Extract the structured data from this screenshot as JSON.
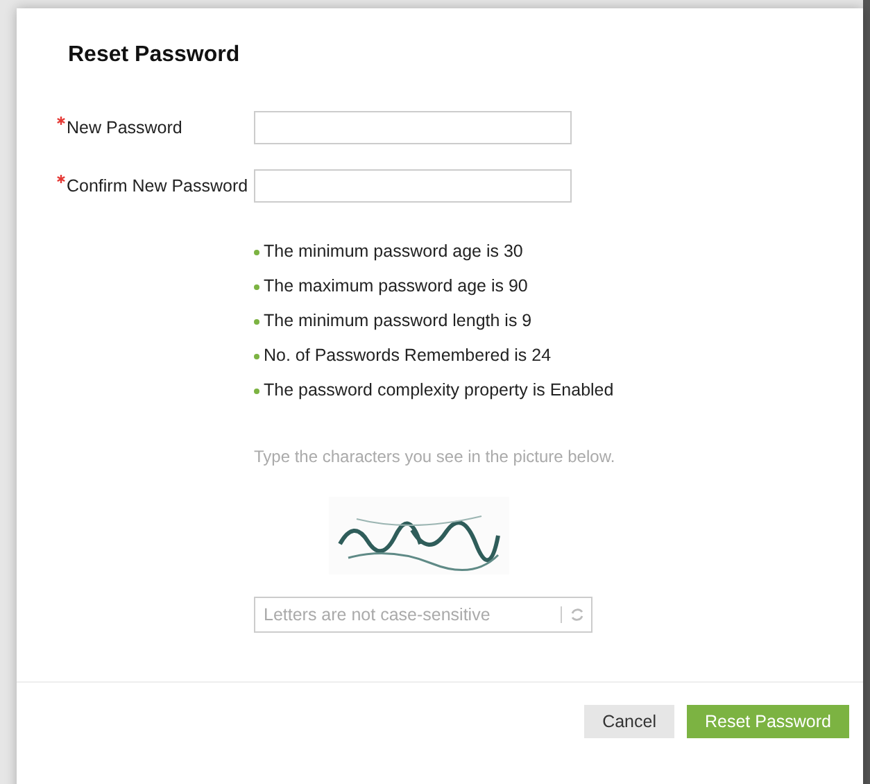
{
  "dialog": {
    "title": "Reset Password"
  },
  "fields": [
    {
      "label": "New Password",
      "required": true
    },
    {
      "label": "Confirm New Password",
      "required": true
    }
  ],
  "rules": [
    "The minimum password age is 30",
    "The maximum password age is 90",
    "The minimum password length is 9",
    "No. of Passwords Remembered is 24",
    "The password complexity property is Enabled"
  ],
  "captcha": {
    "instruction": "Type the characters you see in the picture below.",
    "input": {
      "placeholder": "Letters are not case-sensitive"
    }
  },
  "buttons": [
    {
      "label": "Cancel",
      "kind": "secondary"
    },
    {
      "label": "Reset Password",
      "kind": "primary"
    }
  ]
}
